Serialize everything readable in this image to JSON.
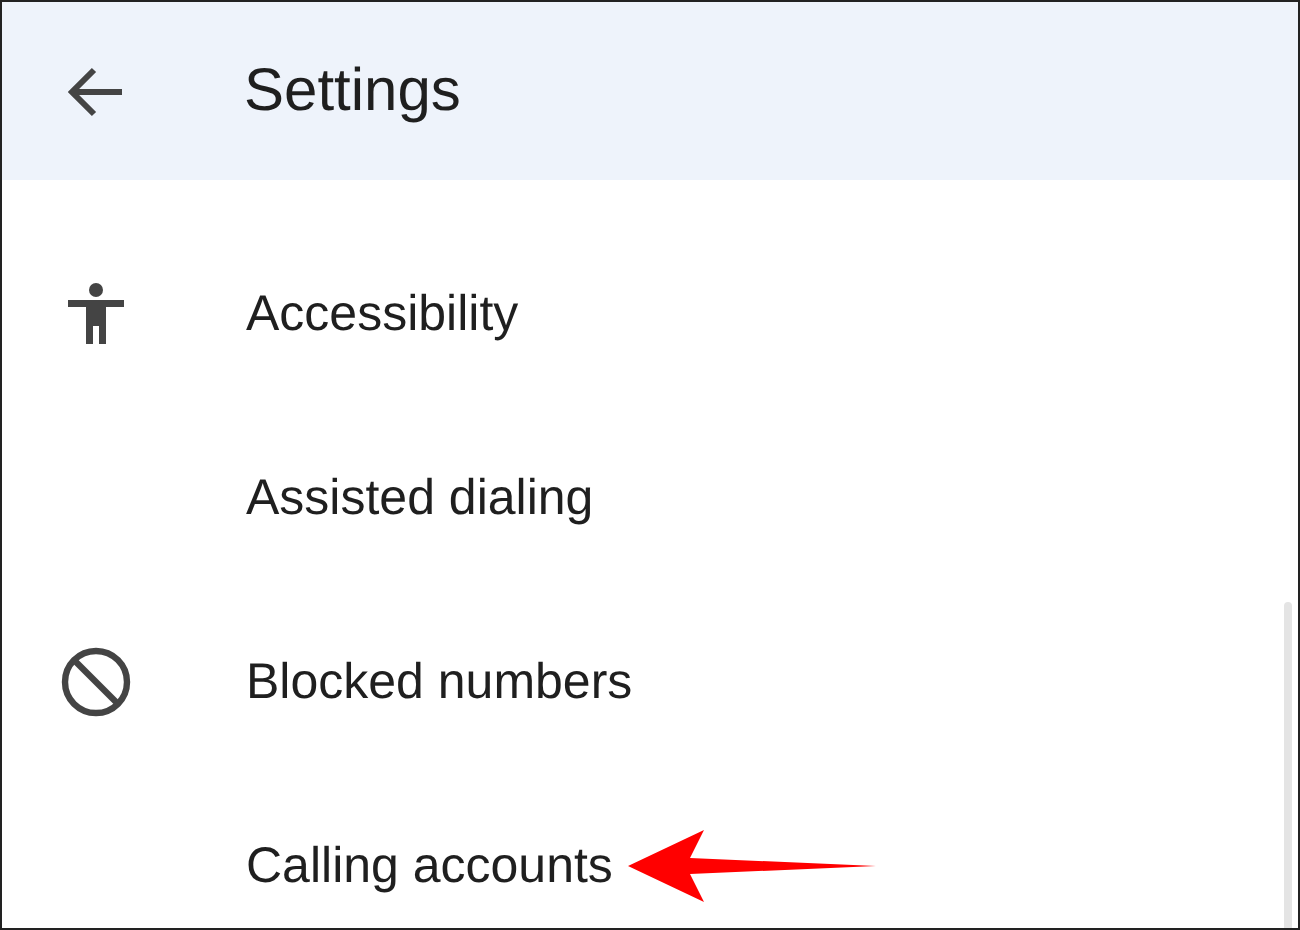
{
  "header": {
    "title": "Settings"
  },
  "items": [
    {
      "label": "Accessibility",
      "kind": "accessibility"
    },
    {
      "label": "Assisted dialing",
      "kind": "plain"
    },
    {
      "label": "Blocked numbers",
      "kind": "blocked"
    },
    {
      "label": "Calling accounts",
      "kind": "plain",
      "annotated": true
    }
  ]
}
